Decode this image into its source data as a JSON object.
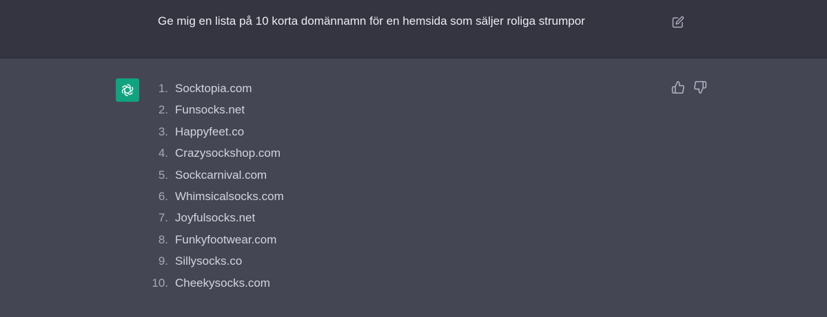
{
  "user": {
    "message": "Ge mig en lista på 10 korta domännamn för en hemsida som säljer roliga strumpor"
  },
  "assistant": {
    "items": [
      {
        "num": "1.",
        "text": "Socktopia.com"
      },
      {
        "num": "2.",
        "text": "Funsocks.net"
      },
      {
        "num": "3.",
        "text": "Happyfeet.co"
      },
      {
        "num": "4.",
        "text": "Crazysockshop.com"
      },
      {
        "num": "5.",
        "text": "Sockcarnival.com"
      },
      {
        "num": "6.",
        "text": "Whimsicalsocks.com"
      },
      {
        "num": "7.",
        "text": "Joyfulsocks.net"
      },
      {
        "num": "8.",
        "text": "Funkyfootwear.com"
      },
      {
        "num": "9.",
        "text": "Sillysocks.co"
      },
      {
        "num": "10.",
        "text": "Cheekysocks.com"
      }
    ]
  },
  "icons": {
    "edit": "edit-icon",
    "avatar": "openai-logo-icon",
    "thumbs_up": "thumbs-up-icon",
    "thumbs_down": "thumbs-down-icon"
  },
  "colors": {
    "user_bg": "#343541",
    "assistant_bg": "#444654",
    "avatar_bg": "#10a37f",
    "text": "#d1d5db"
  }
}
